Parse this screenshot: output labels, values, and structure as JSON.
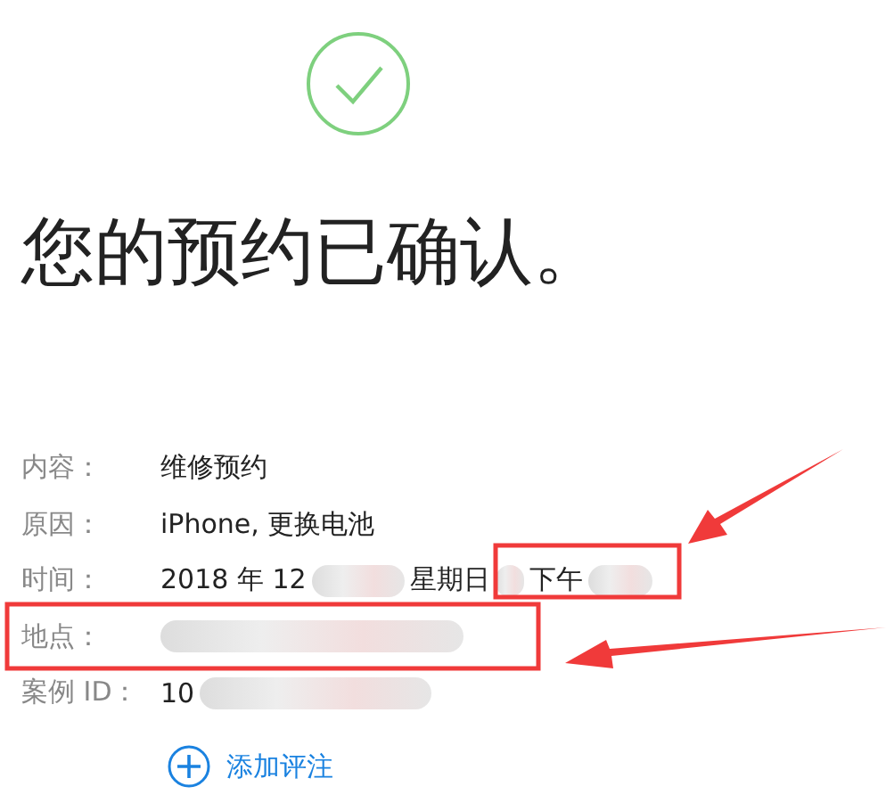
{
  "title": "您的预约已确认。",
  "details": [
    {
      "label": "内容：",
      "value": [
        {
          "kind": "text",
          "text": "维修预约"
        }
      ]
    },
    {
      "label": "原因：",
      "value": [
        {
          "kind": "text",
          "text": "iPhone, 更换电池"
        }
      ]
    },
    {
      "label": "时间：",
      "value": [
        {
          "kind": "text",
          "text": "2018 年 12"
        },
        {
          "kind": "blur"
        },
        {
          "kind": "text",
          "text": "星期日"
        },
        {
          "kind": "blur"
        },
        {
          "kind": "text",
          "text": "下午"
        },
        {
          "kind": "blur"
        }
      ]
    },
    {
      "label": "地点：",
      "value": [
        {
          "kind": "blur"
        }
      ]
    },
    {
      "label": "案例 ID：",
      "value": [
        {
          "kind": "text",
          "text": "10"
        },
        {
          "kind": "blur"
        }
      ]
    }
  ],
  "add_note": {
    "label": "添加评注"
  }
}
